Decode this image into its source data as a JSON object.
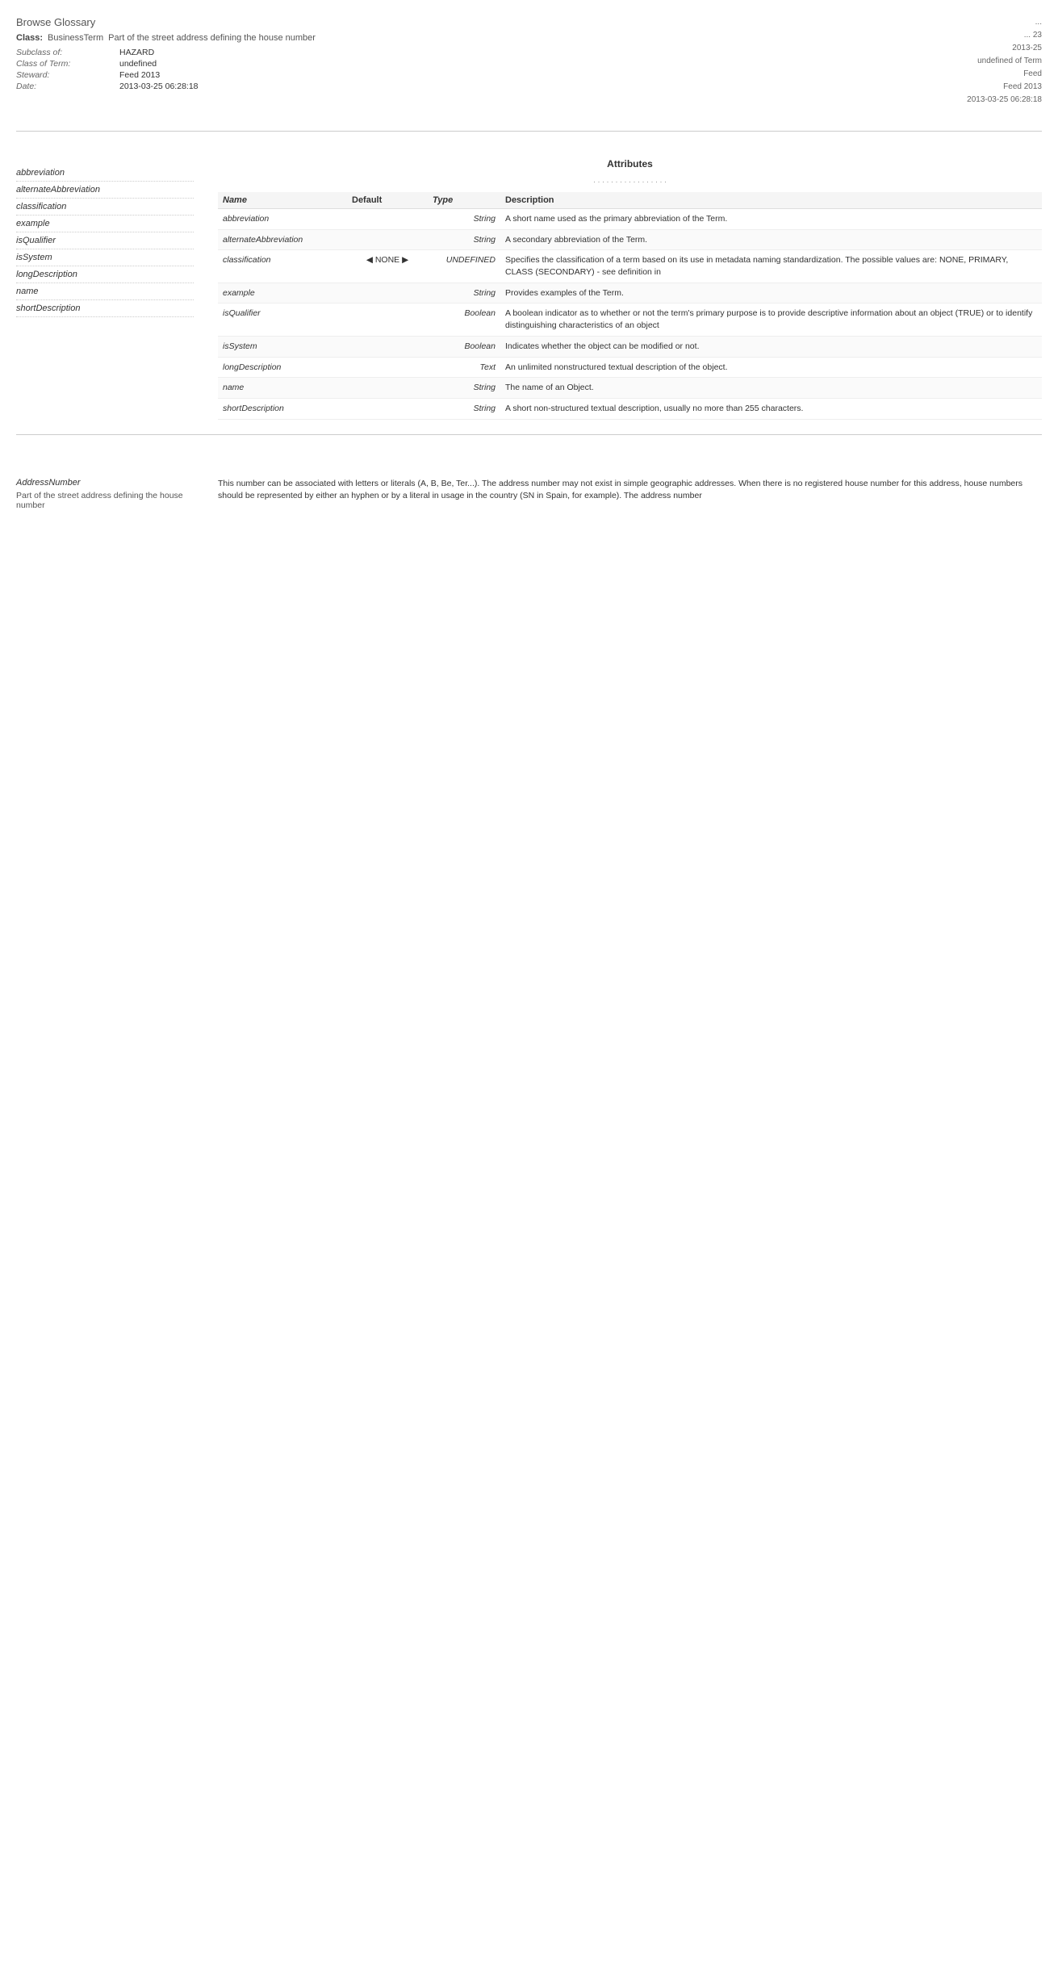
{
  "header": {
    "browse_glossary": "Browse Glossary",
    "class_label": "Class:",
    "class_value": "BusinessTerm",
    "part_label": "Part of the street address defining the house number",
    "meta": {
      "subclass_label": "Subclass of:",
      "subclass_value": "HAZARD",
      "class_of_label": "Class of Term:",
      "class_of_value": "undefined",
      "steward_label": "Steward:",
      "steward_value": "Feed 2013",
      "date_label": "Date:",
      "date_value": "2013-03-25 06:28:18"
    },
    "top_info": {
      "line1": "...",
      "line2": "...",
      "line3": "... 23",
      "line4": "2013-25",
      "line5": "undefined of Term",
      "line6": "Feed",
      "line7": "Feed 2013",
      "line8": "2013-3-25 06:28:18"
    }
  },
  "attributes_section": {
    "title": "Attributes",
    "subtitle": "...",
    "columns": {
      "name": "Name",
      "default": "Default",
      "type": "Type",
      "description": "Description"
    },
    "rows": [
      {
        "name": "abbreviation",
        "default": "",
        "type": "String",
        "description": "A short name used as the primary abbreviation of the Term."
      },
      {
        "name": "alternateAbbreviation",
        "default": "",
        "type": "String",
        "description": "A secondary abbreviation of the Term."
      },
      {
        "name": "classification",
        "default": "NONE",
        "type": "UNDEFINED",
        "description": "Specifies the classification of a term based on its use in metadata naming standardization. The possible values are: NONE, PRIMARY, CLASS (SECONDARY) - see definition in"
      },
      {
        "name": "example",
        "default": "",
        "type": "String",
        "description": "Provides examples of the Term."
      },
      {
        "name": "isQualifier",
        "default": "",
        "type": "Boolean",
        "description": "A boolean indicator as to whether or not the term's primary purpose is to provide descriptive information about an object (TRUE) or to identify distinguishing characteristics of an object"
      },
      {
        "name": "isSystem",
        "default": "",
        "type": "Boolean",
        "description": "Indicates whether the object can be modified or not."
      },
      {
        "name": "longDescription",
        "default": "",
        "type": "Text",
        "description": "An unlimited nonstructured textual description of the object."
      },
      {
        "name": "name",
        "default": "",
        "type": "String",
        "description": "The name of an Object."
      },
      {
        "name": "shortDescription",
        "default": "",
        "type": "String",
        "description": "A short non-structured textual description, usually no more than 255 characters."
      }
    ]
  },
  "left_attributes": [
    "abbreviation",
    "alternateAbbreviation",
    "classification",
    "example",
    "isQualifier",
    "isSystem",
    "longDescription",
    "name",
    "shortDescription"
  ],
  "address_number_section": {
    "title": "AddressNumber",
    "subtitle": "Part of the street address defining the house number",
    "description": "This number can be associated with letters or literals (A, B, Be, Ter...). The address number may not exist in simple geographic addresses. When there is no registered house number for this address, house numbers should be represented by either an hyphen or by a literal in usage in the country (SN in Spain, for example). The address number",
    "field_label": "AddressNumber",
    "field_desc": "Part of the street address defining the house number"
  }
}
